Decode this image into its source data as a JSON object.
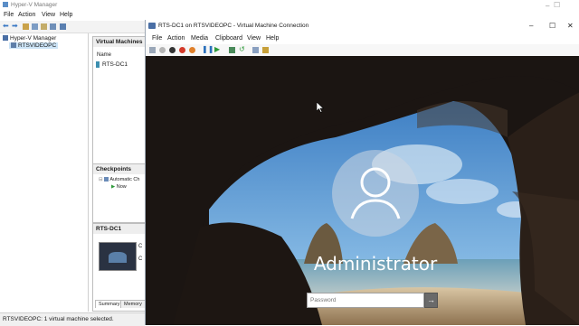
{
  "hyperv": {
    "title": "Hyper-V Manager",
    "menu": [
      "File",
      "Action",
      "View",
      "Help"
    ],
    "tree": {
      "root": "Hyper-V Manager",
      "host": "RTSVIDEOPC"
    },
    "vms_panel": {
      "header": "Virtual Machines",
      "col_name": "Name",
      "vm": "RTS-DC1"
    },
    "checkpoints_panel": {
      "header": "Checkpoints",
      "item": "Automatic Ch",
      "now": "Now"
    },
    "vm_detail_panel": {
      "header": "RTS-DC1",
      "tab_summary": "Summary",
      "tab_memory": "Memory",
      "letter1": "C",
      "letter2": "C"
    },
    "status": "RTSVIDEOPC:  1 virtual machine selected."
  },
  "vmconnect": {
    "title": "RTS-DC1 on RTSVIDEOPC - Virtual Machine Connection",
    "menu": [
      "File",
      "Action",
      "Media",
      "Clipboard",
      "View",
      "Help"
    ],
    "username": "Administrator",
    "password_placeholder": "Password",
    "submit_icon": "→"
  },
  "window_controls": {
    "minimize": "–",
    "maximize": "☐",
    "close": "✕"
  },
  "colors": {
    "accent": "#4a6fa5",
    "sky": "#4f8fd0",
    "cave": "#1b1512",
    "sand": "#c8b79b"
  }
}
